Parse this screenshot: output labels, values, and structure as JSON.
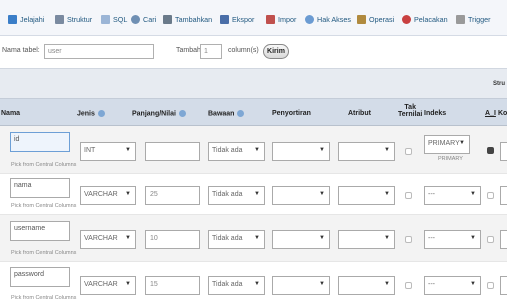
{
  "tabs": [
    {
      "label": "Jelajahi",
      "icon": "browse-icon",
      "color": "#3b7ec8"
    },
    {
      "label": "Struktur",
      "icon": "structure-icon",
      "color": "#7a8aa0"
    },
    {
      "label": "SQL",
      "icon": "sql-icon",
      "color": "#9bb5d6"
    },
    {
      "label": "Cari",
      "icon": "search-icon",
      "color": "#6f8fb3"
    },
    {
      "label": "Tambahkan",
      "icon": "insert-icon",
      "color": "#6a7a8a"
    },
    {
      "label": "Ekspor",
      "icon": "export-icon",
      "color": "#4a6ea8"
    },
    {
      "label": "Impor",
      "icon": "import-icon",
      "color": "#c0504d"
    },
    {
      "label": "Hak Akses",
      "icon": "privileges-icon",
      "color": "#6b9bd2"
    },
    {
      "label": "Operasi",
      "icon": "operations-icon",
      "color": "#b08a3e"
    },
    {
      "label": "Pelacakan",
      "icon": "tracking-icon",
      "color": "#c94040"
    },
    {
      "label": "Trigger",
      "icon": "trigger-icon",
      "color": "#9a9a9a"
    }
  ],
  "table_name": {
    "label": "Nama tabel:",
    "value": "user"
  },
  "add": {
    "label": "Tambah",
    "value": "1",
    "suffix": "column(s)",
    "button": "Kirim"
  },
  "band_label": "Stru",
  "headers": {
    "nama": "Nama",
    "jenis": "Jenis",
    "panjang": "Panjang/Nilai",
    "bawaan": "Bawaan",
    "penyortiran": "Penyortiran",
    "atribut": "Atribut",
    "tak_ternilai_1": "Tak",
    "tak_ternilai_2": "Ternilai",
    "indeks": "Indeks",
    "ai": "A_I",
    "ko": "Ko"
  },
  "pick_label": "Pick from Central Columns",
  "rows": [
    {
      "name": "id",
      "type": "INT",
      "length": "",
      "default": "Tidak ada",
      "index": "PRIMARY",
      "index_sub": "PRIMARY",
      "ai": true
    },
    {
      "name": "nama",
      "type": "VARCHAR",
      "length": "25",
      "default": "Tidak ada",
      "index": "---",
      "index_sub": "",
      "ai": false
    },
    {
      "name": "username",
      "type": "VARCHAR",
      "length": "10",
      "default": "Tidak ada",
      "index": "---",
      "index_sub": "",
      "ai": false
    },
    {
      "name": "password",
      "type": "VARCHAR",
      "length": "15",
      "default": "Tidak ada",
      "index": "---",
      "index_sub": "",
      "ai": false
    }
  ]
}
